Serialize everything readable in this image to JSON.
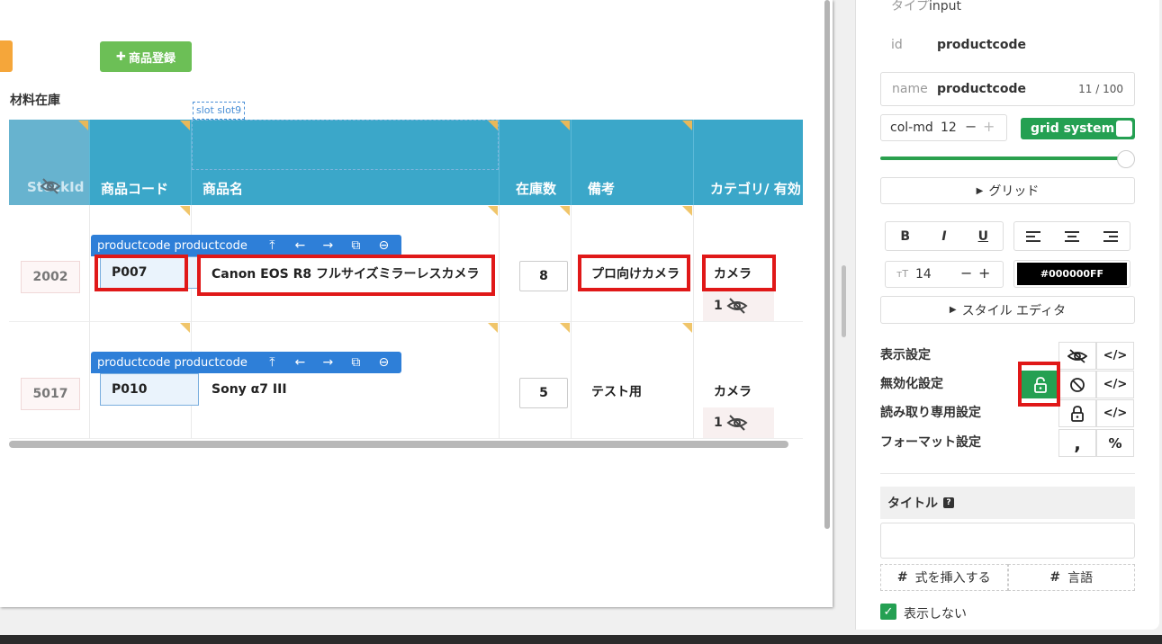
{
  "canvas": {
    "add_button": "商品登録",
    "section_title": "材料在庫",
    "slot_label": "slot slot9"
  },
  "table": {
    "headers": [
      "StockId",
      "商品コード",
      "商品名",
      "在庫数",
      "備考",
      "カテゴリ/ 有効"
    ],
    "rows": [
      {
        "stock_id": "2002",
        "toolbar_label": "productcode productcode",
        "code": "P007",
        "name": "Canon EOS R8 フルサイズミラーレスカメラ",
        "qty": "8",
        "note": "プロ向けカメラ",
        "category": "カメラ",
        "category_count": "1"
      },
      {
        "stock_id": "5017",
        "toolbar_label": "productcode productcode",
        "code": "P010",
        "name": "Sony α7 III",
        "qty": "5",
        "note": "テスト用",
        "category": "カメラ",
        "category_count": "1"
      }
    ]
  },
  "panel": {
    "type_label": "タイプ",
    "type_value": "input",
    "id_label": "id",
    "id_value": "productcode",
    "name_label": "name",
    "name_value": "productcode",
    "name_count": "11 / 100",
    "col_label": "col-md",
    "col_value": "12",
    "grid_system_label": "grid system",
    "grid_button": "グリッド",
    "font_size": "14",
    "color_value": "#000000FF",
    "style_editor": "スタイル エディタ",
    "settings": [
      "表示設定",
      "無効化設定",
      "読み取り専用設定",
      "フォーマット設定"
    ],
    "title_label": "タイトル",
    "insert_expr": "式を挿入する",
    "language": "言語",
    "hide_label": "表示しない"
  },
  "colors": {
    "header_bg": "#3ba7c9",
    "accent_green": "#24a052",
    "toolbar_blue": "#2e7fd8",
    "highlight_red": "#e01818",
    "add_button_green": "#6cbf56"
  }
}
